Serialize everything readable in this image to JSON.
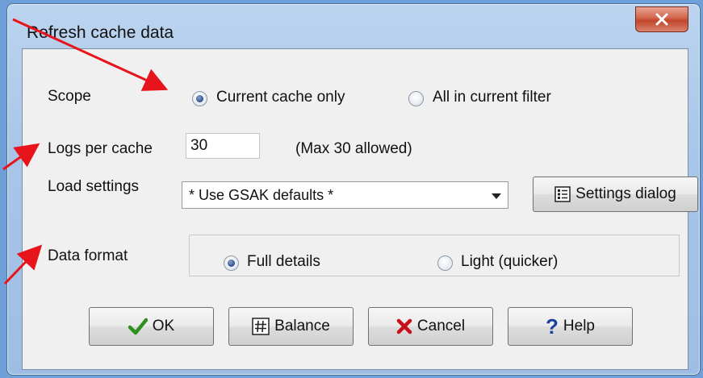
{
  "window": {
    "title": "Refresh cache data",
    "close_label": "x"
  },
  "scope": {
    "label": "Scope",
    "options": [
      {
        "label": "Current cache only",
        "selected": true
      },
      {
        "label": "All in current filter",
        "selected": false
      }
    ]
  },
  "logs": {
    "label": "Logs per cache",
    "value": "30",
    "hint": "(Max 30 allowed)"
  },
  "load_settings": {
    "label": "Load settings",
    "selected": "* Use GSAK defaults *",
    "settings_button": "Settings dialog"
  },
  "data_format": {
    "label": "Data format",
    "options": [
      {
        "label": "Full details",
        "selected": true
      },
      {
        "label": "Light (quicker)",
        "selected": false
      }
    ]
  },
  "buttons": {
    "ok": "OK",
    "balance": "Balance",
    "cancel": "Cancel",
    "help": "Help"
  },
  "colors": {
    "annotation_arrow": "#e8141c",
    "ok_check": "#2f8f1f",
    "cancel_x": "#c8101a",
    "help_mark": "#1b3f9e"
  },
  "icons": [
    "close-icon",
    "settings-icon",
    "checkmark-icon",
    "hash-icon",
    "cross-icon",
    "question-icon"
  ]
}
